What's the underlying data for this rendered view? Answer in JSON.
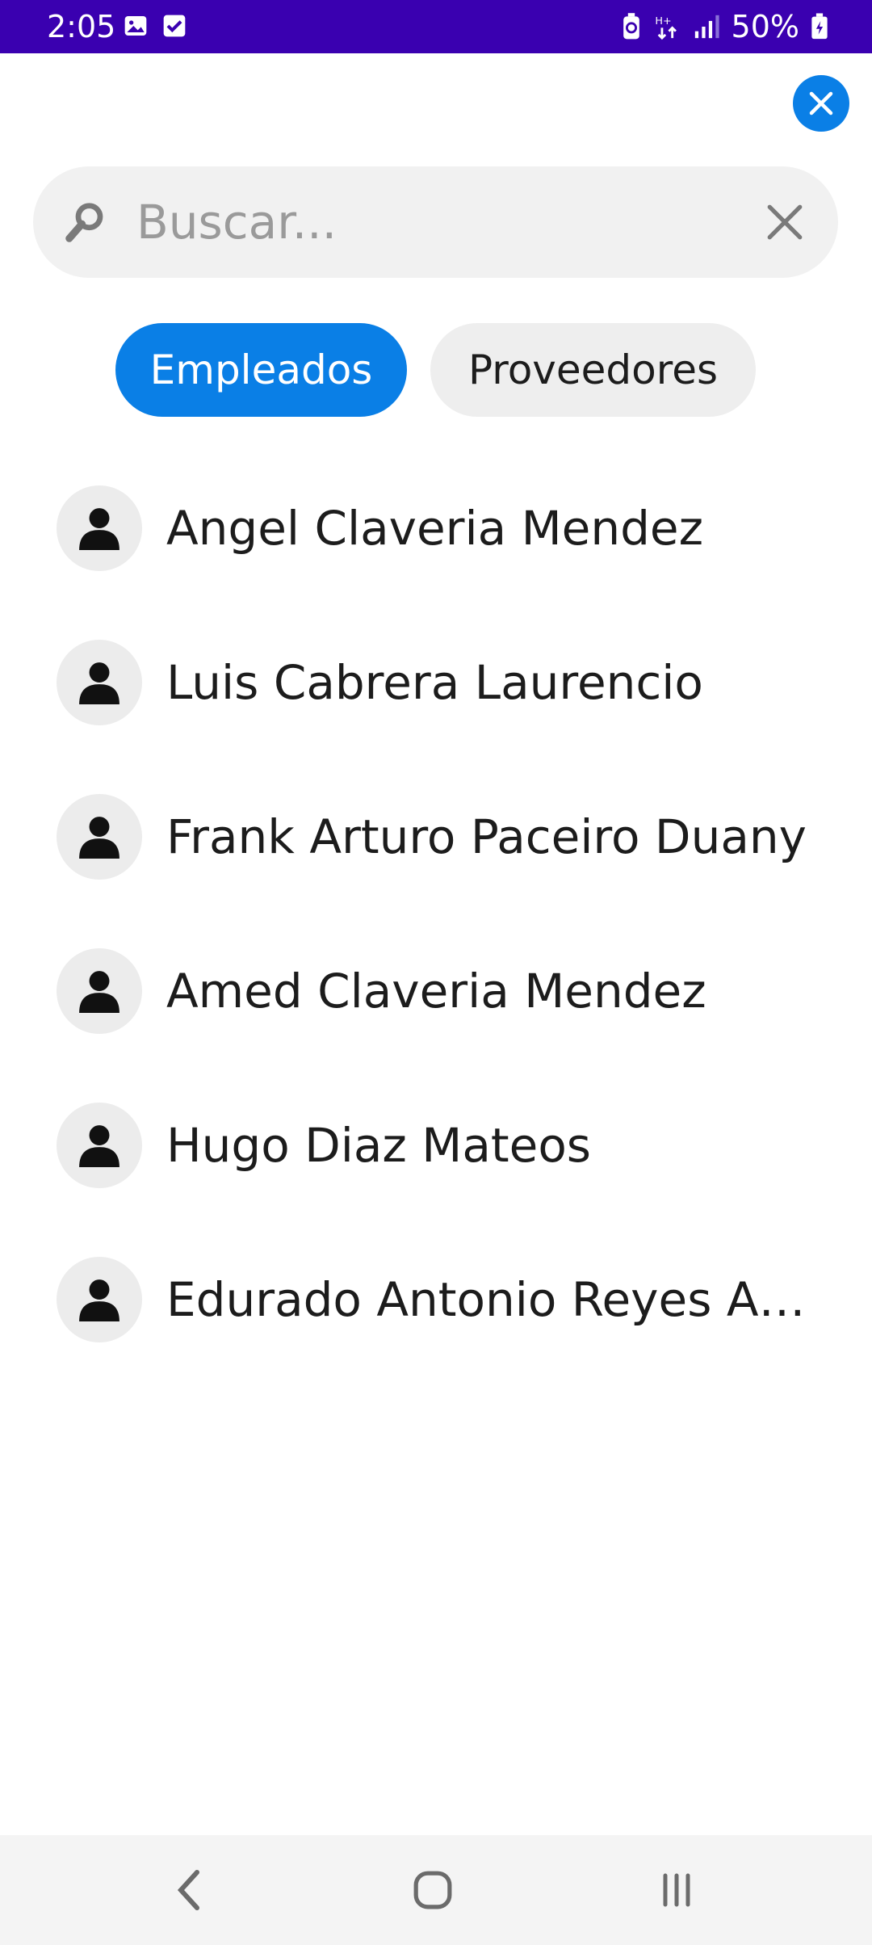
{
  "status_bar": {
    "time": "2:05",
    "battery": "50%",
    "left_icons": [
      "gallery-icon",
      "checkbox-icon"
    ],
    "right_icons": [
      "battery-saver-icon",
      "data-icon",
      "signal-icon",
      "battery-icon"
    ]
  },
  "search": {
    "placeholder": "Buscar...",
    "value": ""
  },
  "tabs": [
    {
      "label": "Empleados",
      "active": true
    },
    {
      "label": "Proveedores",
      "active": false
    }
  ],
  "people": [
    {
      "name": "Angel Claveria Mendez"
    },
    {
      "name": "Luis Cabrera Laurencio"
    },
    {
      "name": "Frank Arturo Paceiro Duany"
    },
    {
      "name": "Amed Claveria Mendez"
    },
    {
      "name": "Hugo Diaz Mateos"
    },
    {
      "name": "Edurado Antonio Reyes Ar..."
    }
  ],
  "colors": {
    "status_bar": "#3a00b0",
    "accent": "#0a7fe6",
    "search_bg": "#f1f1f1",
    "chip_bg": "#eeeeee"
  }
}
